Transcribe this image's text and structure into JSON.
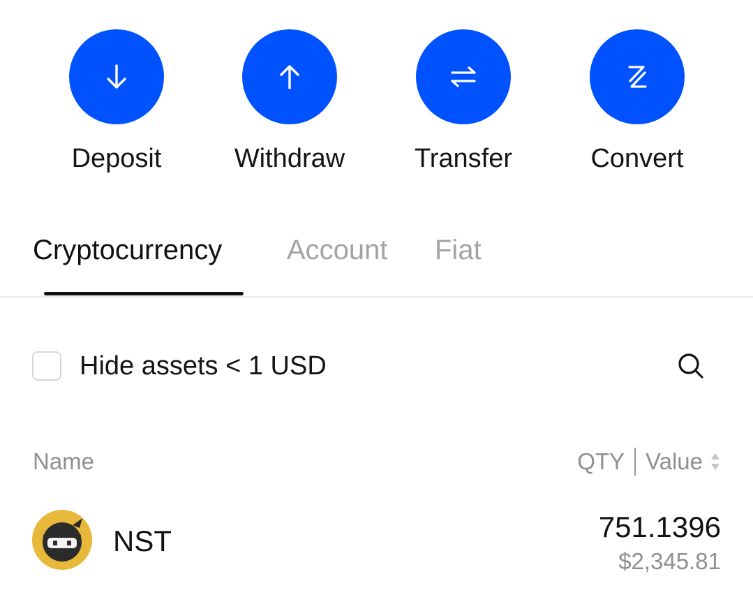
{
  "actions": [
    {
      "label": "Deposit",
      "icon": "arrow-down-icon"
    },
    {
      "label": "Withdraw",
      "icon": "arrow-up-icon"
    },
    {
      "label": "Transfer",
      "icon": "transfer-arrows-icon"
    },
    {
      "label": "Convert",
      "icon": "convert-icon"
    }
  ],
  "tabs": [
    {
      "label": "Cryptocurrency",
      "active": true
    },
    {
      "label": "Account",
      "active": false
    },
    {
      "label": "Fiat",
      "active": false
    }
  ],
  "filter": {
    "hide_small_label": "Hide assets < 1 USD",
    "checked": false
  },
  "list_header": {
    "name": "Name",
    "qty": "QTY",
    "value": "Value"
  },
  "assets": [
    {
      "symbol": "NST",
      "qty": "751.1396",
      "value": "$2,345.81",
      "logo_icon": "ninja-coin-icon"
    }
  ],
  "colors": {
    "accent": "#0052ff",
    "text_primary": "#111111",
    "text_secondary": "#8f8f8f",
    "tab_inactive": "#a3a3a3",
    "coin_gold": "#e8b83a"
  }
}
